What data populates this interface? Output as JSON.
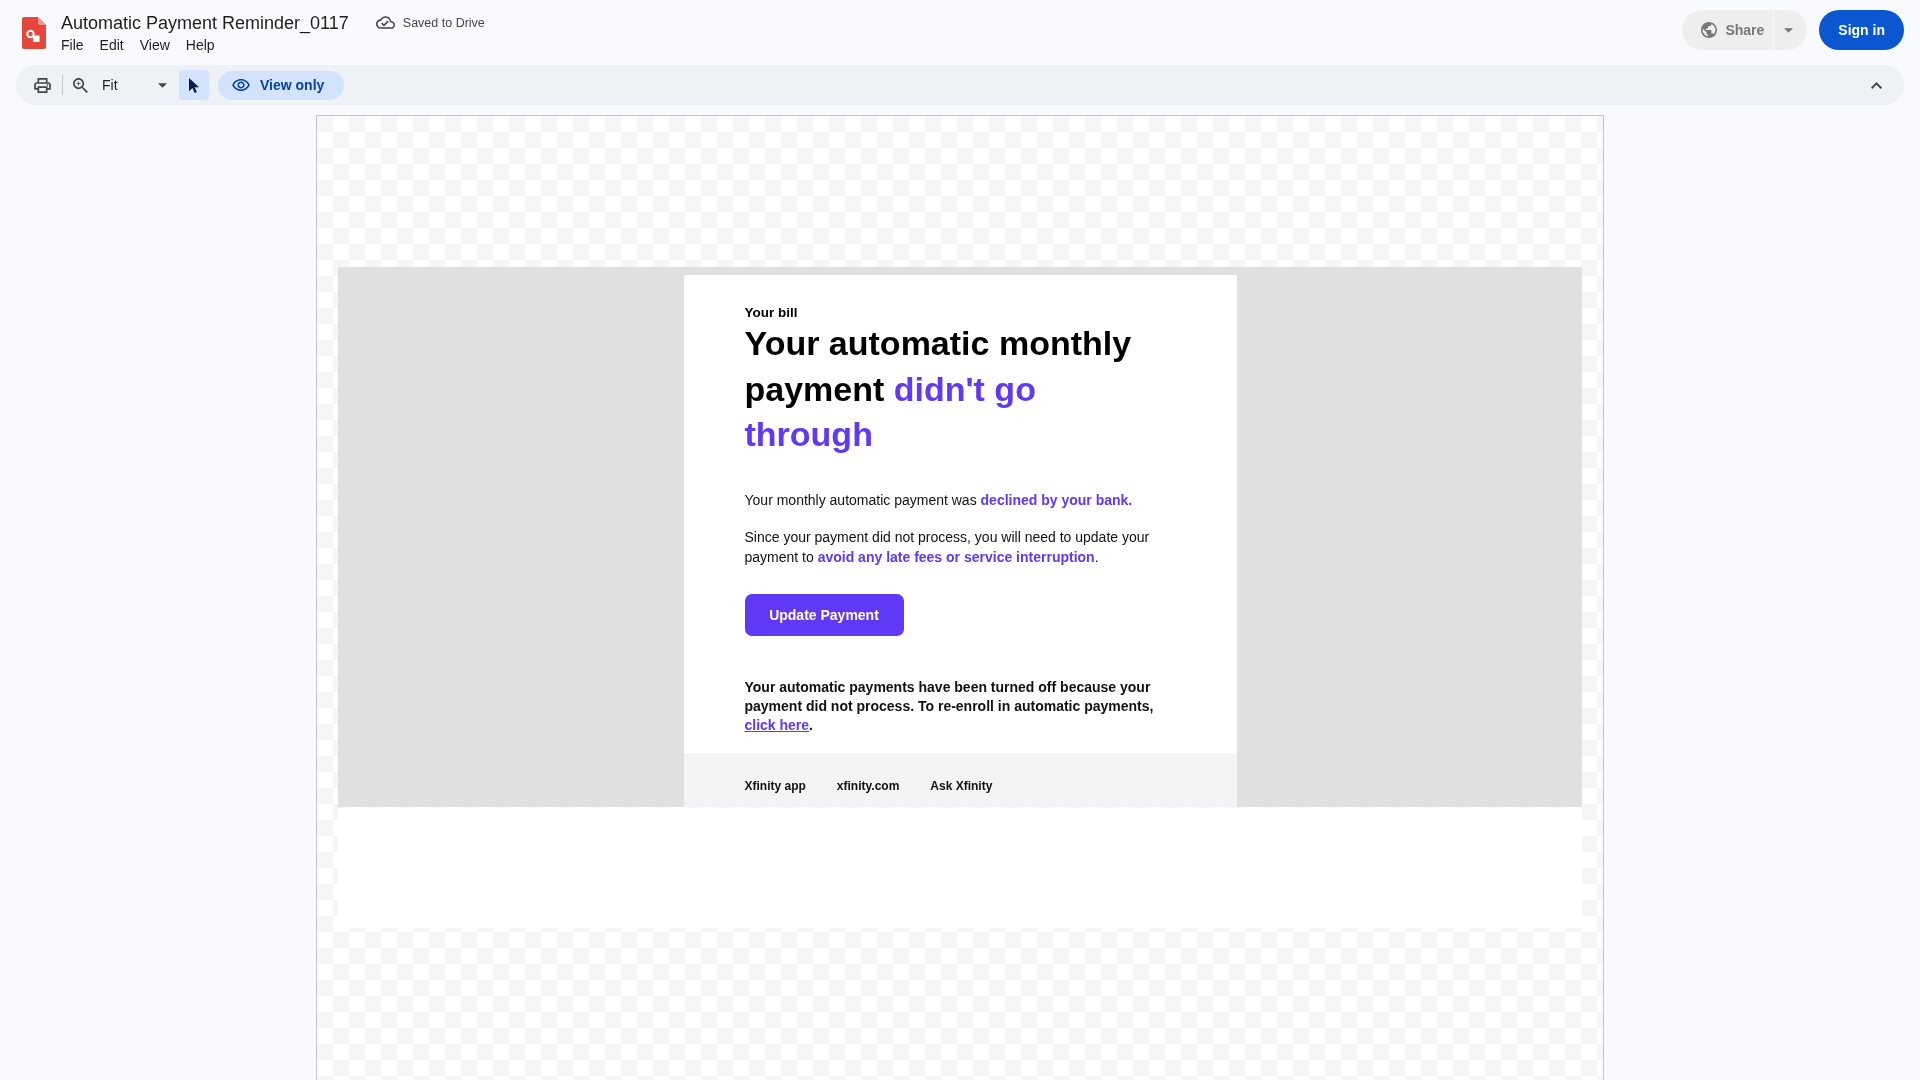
{
  "header": {
    "title": "Automatic Payment Reminder_0117",
    "save_status": "Saved to Drive",
    "menu": [
      "File",
      "Edit",
      "View",
      "Help"
    ]
  },
  "actions": {
    "share": {
      "label": "Share",
      "disabled": true
    },
    "sign_in": "Sign in"
  },
  "toolbar": {
    "zoom": "Fit",
    "pointer_tool": {
      "selected": true
    },
    "mode": "View only"
  },
  "email": {
    "eyebrow": "Your bill",
    "heading": [
      {
        "kind": "text",
        "text": "Your automatic monthly payment "
      },
      {
        "kind": "accent",
        "text": "didn't go through"
      }
    ],
    "paragraphs": [
      {
        "segments": [
          {
            "kind": "text",
            "text": "Your monthly automatic payment was "
          },
          {
            "kind": "accent",
            "text": "declined by your bank."
          }
        ]
      },
      {
        "segments": [
          {
            "kind": "text",
            "text": "Since your payment did not process, you will need to update your payment to "
          },
          {
            "kind": "accent",
            "text": "avoid any late fees or service interruption"
          },
          {
            "kind": "text",
            "text": "."
          }
        ]
      }
    ],
    "button": "Update Payment",
    "notice": [
      {
        "kind": "text",
        "text": "Your automatic payments have been turned off because your payment did not process. To re-enroll in automatic payments, "
      },
      {
        "kind": "link",
        "text": "click here"
      },
      {
        "kind": "text",
        "text": "."
      }
    ],
    "footer_links": [
      "Xfinity app",
      "xfinity.com",
      "Ask Xfinity"
    ]
  }
}
